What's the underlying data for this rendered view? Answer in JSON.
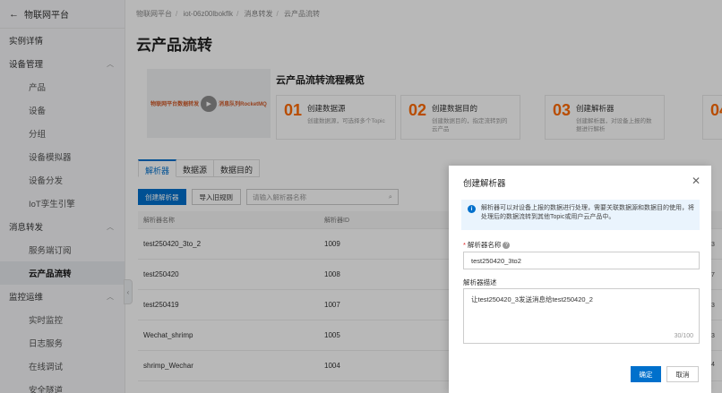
{
  "sidebar": {
    "back_label": "物联网平台",
    "items": [
      {
        "label": "实例详情",
        "type": "top"
      },
      {
        "label": "设备管理",
        "type": "group"
      },
      {
        "label": "产品",
        "type": "sub"
      },
      {
        "label": "设备",
        "type": "sub"
      },
      {
        "label": "分组",
        "type": "sub"
      },
      {
        "label": "设备模拟器",
        "type": "sub"
      },
      {
        "label": "设备分发",
        "type": "sub"
      },
      {
        "label": "IoT孪生引擎",
        "type": "sub"
      },
      {
        "label": "消息转发",
        "type": "group"
      },
      {
        "label": "服务端订阅",
        "type": "sub"
      },
      {
        "label": "云产品流转",
        "type": "sub",
        "active": true
      },
      {
        "label": "监控运维",
        "type": "group"
      },
      {
        "label": "实时监控",
        "type": "sub"
      },
      {
        "label": "日志服务",
        "type": "sub"
      },
      {
        "label": "在线调试",
        "type": "sub"
      },
      {
        "label": "安全隧道",
        "type": "sub"
      }
    ]
  },
  "breadcrumb": [
    "物联网平台",
    "iot-06z00lbokflk",
    "消息转发",
    "云产品流转"
  ],
  "page_title": "云产品流转",
  "overview": {
    "image_text_left": "物联网平台数据转发",
    "image_text_right": "消息队列RocketMQ",
    "title": "云产品流转流程概览",
    "steps": [
      {
        "num": "01",
        "title": "创建数据源",
        "desc": "创建数据源，可选择多个Topic"
      },
      {
        "num": "02",
        "title": "创建数据目的",
        "desc": "创建数据目的，指定流转到的云产品"
      },
      {
        "num": "03",
        "title": "创建解析器",
        "desc": "创建解析器，对设备上报的数据进行解析"
      },
      {
        "num": "04",
        "title": "",
        "desc": ""
      }
    ]
  },
  "tabs": [
    "解析器",
    "数据源",
    "数据目的"
  ],
  "toolbar": {
    "create": "创建解析器",
    "import": "导入旧规则",
    "search_placeholder": "请输入解析器名称"
  },
  "table": {
    "headers": [
      "解析器名称",
      "解析器ID"
    ],
    "rows": [
      [
        "test250420_3to_2",
        "1009"
      ],
      [
        "test250420",
        "1008"
      ],
      [
        "test250419",
        "1007"
      ],
      [
        "Wechat_shrimp",
        "1005"
      ],
      [
        "shrimp_Wechar",
        "1004"
      ]
    ]
  },
  "drawer": {
    "title": "创建解析器",
    "notice": "解析器可以对设备上报的数据进行处理，需要关联数据源和数据目的使用，将处理后的数据流转到其他Topic或用户云产品中。",
    "name_label": "解析器名称",
    "name_value": "test250420_3to2",
    "desc_label": "解析器描述",
    "desc_value": "让test250420_3发送消息给test250420_2",
    "counter": "30/100",
    "ok": "确定",
    "cancel": "取消"
  },
  "edge_numbers": [
    "3",
    "7",
    "3",
    "3",
    "4"
  ]
}
